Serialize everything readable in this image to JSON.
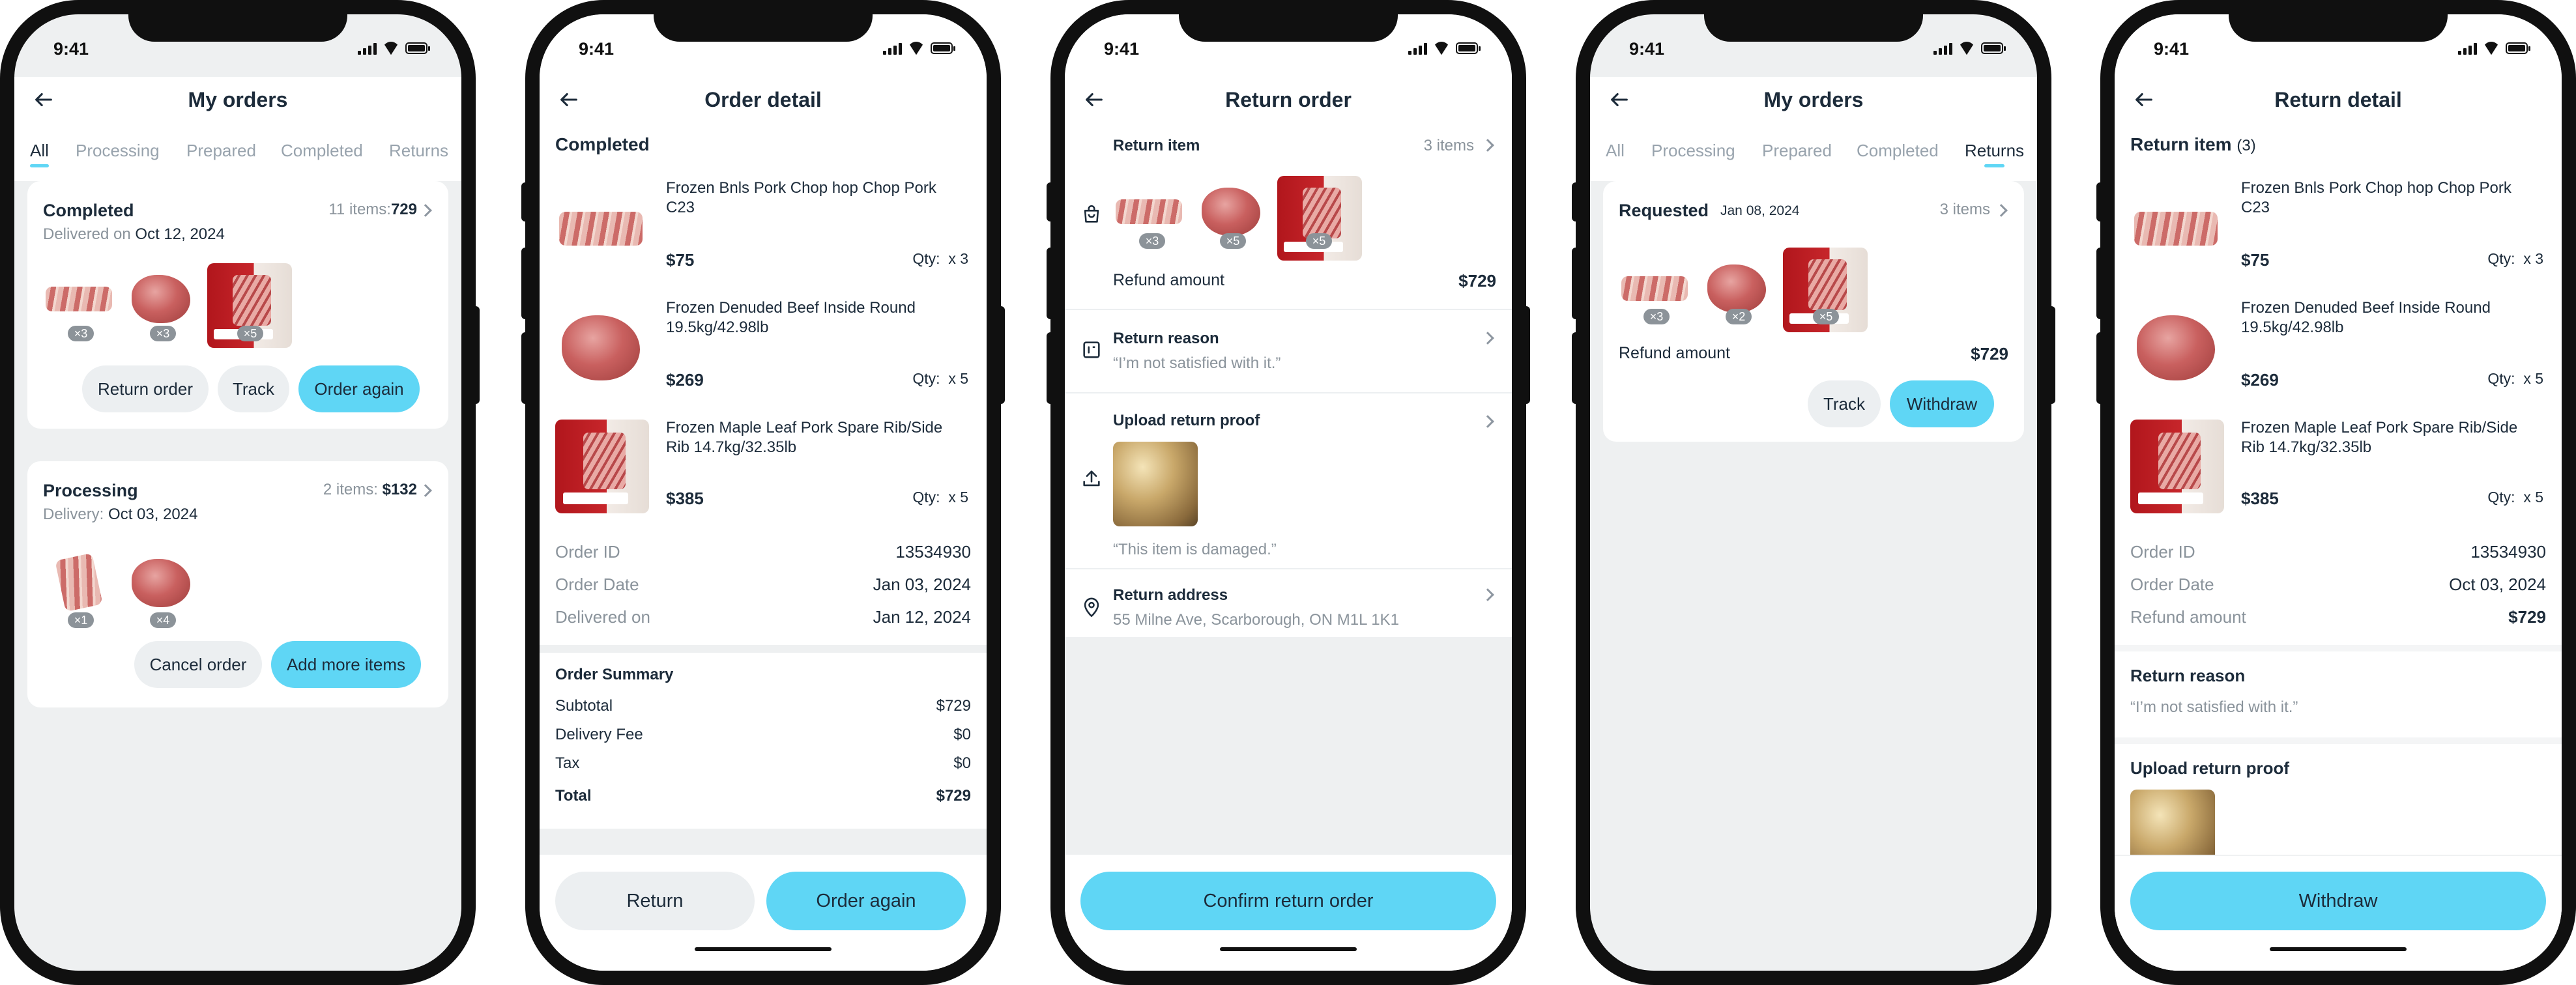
{
  "status_time": "9:41",
  "accent": "#5fd6f5",
  "s1": {
    "title": "My orders",
    "tabs": [
      "All",
      "Processing",
      "Prepared",
      "Completed",
      "Returns"
    ],
    "active_tab": "All",
    "orders": [
      {
        "status": "Completed",
        "count": "11 items:",
        "total": "729",
        "date_label": "Delivered on",
        "date": "Oct 12, 2024",
        "qty": [
          "×3",
          "×3",
          "×5"
        ],
        "buttons": [
          "Return order",
          "Track",
          "Order again"
        ]
      },
      {
        "status": "Processing",
        "count": "2 items:",
        "total": "$132",
        "date_label": "Delivery:",
        "date": "Oct 03, 2024",
        "qty": [
          "×1",
          "×4"
        ],
        "buttons": [
          "Cancel order",
          "Add more items"
        ]
      }
    ]
  },
  "s2": {
    "title": "Order detail",
    "section": "Completed",
    "items": [
      {
        "name": "Frozen Bnls Pork Chop hop Chop Pork C23",
        "price": "$75",
        "qty_label": "Qty:",
        "qty": "x 3"
      },
      {
        "name": "Frozen Denuded Beef Inside Round 19.5kg/42.98lb",
        "price": "$269",
        "qty_label": "Qty:",
        "qty": "x 5"
      },
      {
        "name": "Frozen Maple Leaf Pork Spare Rib/Side Rib 14.7kg/32.35lb",
        "price": "$385",
        "qty_label": "Qty:",
        "qty": "x 5"
      }
    ],
    "info": [
      {
        "label": "Order ID",
        "value": "13534930"
      },
      {
        "label": "Order Date",
        "value": "Jan 03, 2024"
      },
      {
        "label": "Delivered on",
        "value": "Jan 12, 2024"
      }
    ],
    "summary_title": "Order Summary",
    "summary": [
      {
        "label": "Subtotal",
        "value": "$729"
      },
      {
        "label": "Delivery Fee",
        "value": "$0"
      },
      {
        "label": "Tax",
        "value": "$0"
      },
      {
        "label": "Total",
        "value": "$729"
      }
    ],
    "buttons": [
      "Return",
      "Order again"
    ]
  },
  "s3": {
    "title": "Return order",
    "return_item": "Return item",
    "items_count": "3 items",
    "qty": [
      "×3",
      "×5",
      "×5"
    ],
    "refund_label": "Refund amount",
    "refund": "$729",
    "reason_title": "Return reason",
    "reason": "“I’m not satisfied with it.”",
    "proof_title": "Upload return proof",
    "proof_caption": "“This item is damaged.”",
    "address_title": "Return address",
    "address": "55 Milne Ave, Scarborough, ON M1L 1K1",
    "confirm": "Confirm return order"
  },
  "s4": {
    "title": "My orders",
    "tabs": [
      "All",
      "Processing",
      "Prepared",
      "Completed",
      "Returns"
    ],
    "active_tab": "Returns",
    "status": "Requested",
    "date": "Jan 08, 2024",
    "items_count": "3 items",
    "qty": [
      "×3",
      "×2",
      "×5"
    ],
    "refund_label": "Refund amount",
    "refund": "$729",
    "buttons": [
      "Track",
      "Withdraw"
    ]
  },
  "s5": {
    "title": "Return detail",
    "return_item": "Return item",
    "return_item_count": "(3)",
    "items": [
      {
        "name": "Frozen Bnls Pork Chop hop Chop Pork C23",
        "price": "$75",
        "qty_label": "Qty:",
        "qty": "x 3"
      },
      {
        "name": "Frozen Denuded Beef Inside Round 19.5kg/42.98lb",
        "price": "$269",
        "qty_label": "Qty:",
        "qty": "x 5"
      },
      {
        "name": "Frozen Maple Leaf Pork Spare Rib/Side Rib 14.7kg/32.35lb",
        "price": "$385",
        "qty_label": "Qty:",
        "qty": "x 5"
      }
    ],
    "info": [
      {
        "label": "Order ID",
        "value": "13534930"
      },
      {
        "label": "Order Date",
        "value": "Oct 03, 2024"
      },
      {
        "label": "Refund amount",
        "value": "$729"
      }
    ],
    "reason_title": "Return reason",
    "reason": "“I’m not satisfied with it.”",
    "proof_title": "Upload return proof",
    "withdraw": "Withdraw"
  }
}
